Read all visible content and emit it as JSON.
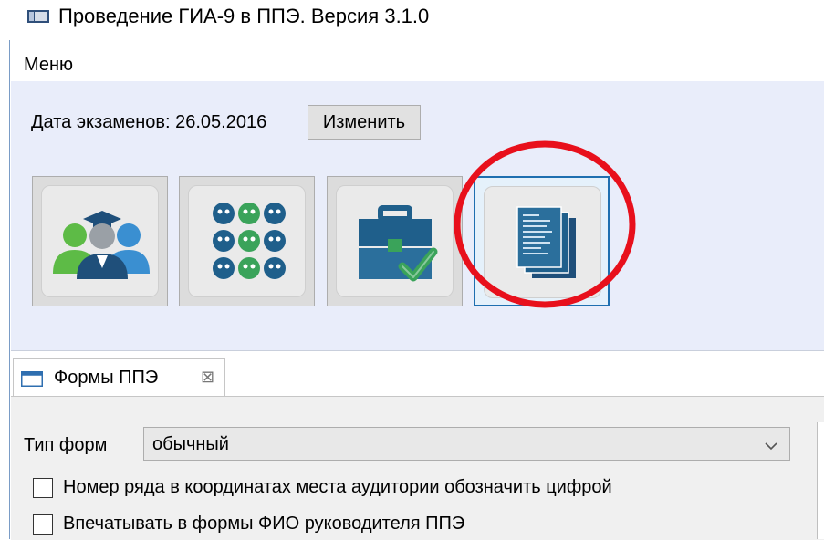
{
  "window": {
    "title": "Проведение ГИА-9 в ППЭ. Версия 3.1.0",
    "icon": "app-window-icon"
  },
  "menu": {
    "items": [
      {
        "label": "Меню"
      }
    ]
  },
  "toolbar": {
    "date_label": "Дата экзаменов: 26.05.2016",
    "change_button": "Изменить",
    "tools": [
      {
        "icon": "participants-icon",
        "selected": false
      },
      {
        "icon": "auditorium-seats-icon",
        "selected": false
      },
      {
        "icon": "briefcase-check-icon",
        "selected": false
      },
      {
        "icon": "documents-icon",
        "selected": true
      }
    ],
    "annotation": {
      "shape": "circle",
      "color": "#e8101c",
      "target": "documents-button"
    }
  },
  "panel": {
    "tab": {
      "label": "Формы ППЭ",
      "icon": "window-icon",
      "close_glyph": "⊠"
    },
    "form_type": {
      "label": "Тип форм",
      "value": "обычный",
      "icon": "chevron-down-icon"
    },
    "checkboxes": [
      {
        "label": "Номер ряда в координатах места аудитории обозначить цифрой",
        "checked": false
      },
      {
        "label": "Впечатывать в формы ФИО руководителя ППЭ",
        "checked": false
      }
    ]
  },
  "colors": {
    "accent": "#1f6fb0",
    "toolbar_bg": "#e9edfa",
    "icon_blue": "#1f5f8b",
    "icon_green": "#3aa35a",
    "annotation": "#e8101c"
  }
}
